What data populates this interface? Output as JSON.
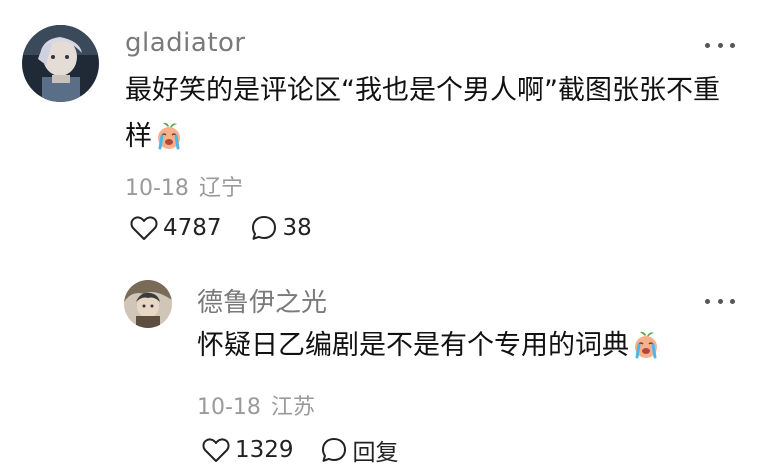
{
  "comments": [
    {
      "username": "gladiator",
      "text": "最好笑的是评论区“我也是个男人啊”截图张张不重样",
      "emoji": "crying-peach-emoji",
      "date": "10-18",
      "location": "辽宁",
      "likes": "4787",
      "replies": "38"
    },
    {
      "username": "德鲁伊之光",
      "text": "怀疑日乙编剧是不是有个专用的词典",
      "emoji": "crying-peach-emoji",
      "date": "10-18",
      "location": "江苏",
      "likes": "1329",
      "reply_label": "回复"
    }
  ],
  "icons": {
    "like": "heart-outline-icon",
    "comment": "speech-bubble-icon",
    "more": "more-dots-icon"
  },
  "colors": {
    "username": "#7a7a7a",
    "meta": "#9a9a9a",
    "text": "#111111"
  }
}
